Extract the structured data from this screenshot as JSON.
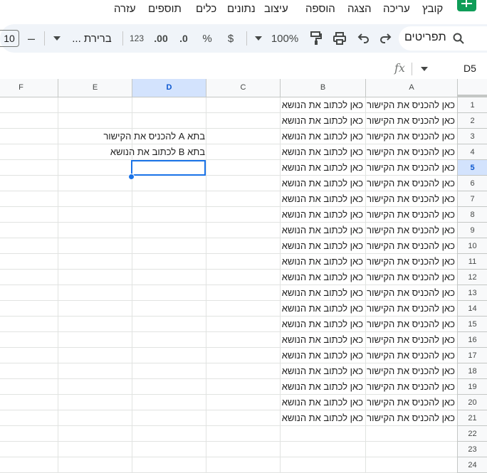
{
  "menu": [
    "קובץ",
    "עריכה",
    "הצגה",
    "הוספה",
    "עיצוב",
    "נתונים",
    "כלים",
    "תוספים",
    "עזרה"
  ],
  "toolbar": {
    "search_label": "תפריטים",
    "zoom": "100%",
    "currency": "$",
    "percent": "%",
    "decrease_decimal": ".0",
    "increase_decimal": ".00",
    "more_formats": "123",
    "font": "ברירת ...",
    "font_size": "10",
    "minus": "–"
  },
  "formula_bar": {
    "cell_ref": "D5",
    "fx": "fx"
  },
  "columns": [
    "A",
    "B",
    "C",
    "D",
    "E",
    "F"
  ],
  "selected_column": "D",
  "selected_row": 5,
  "row_numbers": [
    1,
    2,
    3,
    4,
    5,
    6,
    7,
    8,
    9,
    10,
    11,
    12,
    13,
    14,
    15,
    16,
    17,
    18,
    19,
    20,
    21,
    22,
    23,
    24
  ],
  "col_a_text": "כאן להכניס את הקישור",
  "col_b_text": "כאן לכתוב את הנושא",
  "filled_rows": 21,
  "notes": {
    "d3": "בתא A להכניס את הקישור",
    "d4": "בתא B לכתוב את הנושא"
  }
}
